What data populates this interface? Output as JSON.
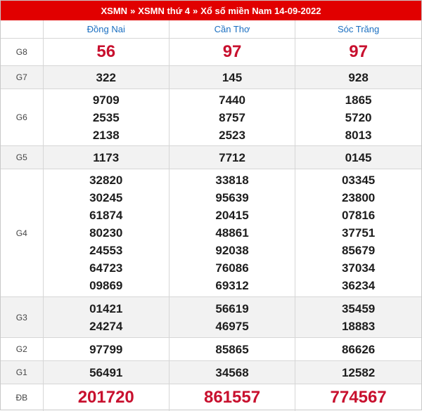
{
  "title": {
    "link1": "XSMN",
    "sep1": "»",
    "link2": "XSMN thứ 4",
    "sep2": "»",
    "link3": "Xổ số miền Nam 14-09-2022"
  },
  "provinces": [
    "Đồng Nai",
    "Cần Thơ",
    "Sóc Trăng"
  ],
  "rows": [
    {
      "label": "G8",
      "big": true,
      "cols": [
        [
          "56"
        ],
        [
          "97"
        ],
        [
          "97"
        ]
      ]
    },
    {
      "label": "G7",
      "cols": [
        [
          "322"
        ],
        [
          "145"
        ],
        [
          "928"
        ]
      ]
    },
    {
      "label": "G6",
      "cols": [
        [
          "9709",
          "2535",
          "2138"
        ],
        [
          "7440",
          "8757",
          "2523"
        ],
        [
          "1865",
          "5720",
          "8013"
        ]
      ]
    },
    {
      "label": "G5",
      "cols": [
        [
          "1173"
        ],
        [
          "7712"
        ],
        [
          "0145"
        ]
      ]
    },
    {
      "label": "G4",
      "cols": [
        [
          "32820",
          "30245",
          "61874",
          "80230",
          "24553",
          "64723",
          "09869"
        ],
        [
          "33818",
          "95639",
          "20415",
          "48861",
          "92038",
          "76086",
          "69312"
        ],
        [
          "03345",
          "23800",
          "07816",
          "37751",
          "85679",
          "37034",
          "36234"
        ]
      ]
    },
    {
      "label": "G3",
      "cols": [
        [
          "01421",
          "24274"
        ],
        [
          "56619",
          "46975"
        ],
        [
          "35459",
          "18883"
        ]
      ]
    },
    {
      "label": "G2",
      "cols": [
        [
          "97799"
        ],
        [
          "85865"
        ],
        [
          "86626"
        ]
      ]
    },
    {
      "label": "G1",
      "cols": [
        [
          "56491"
        ],
        [
          "34568"
        ],
        [
          "12582"
        ]
      ]
    },
    {
      "label": "ĐB",
      "big": true,
      "cols": [
        [
          "201720"
        ],
        [
          "861557"
        ],
        [
          "774567"
        ]
      ]
    }
  ]
}
